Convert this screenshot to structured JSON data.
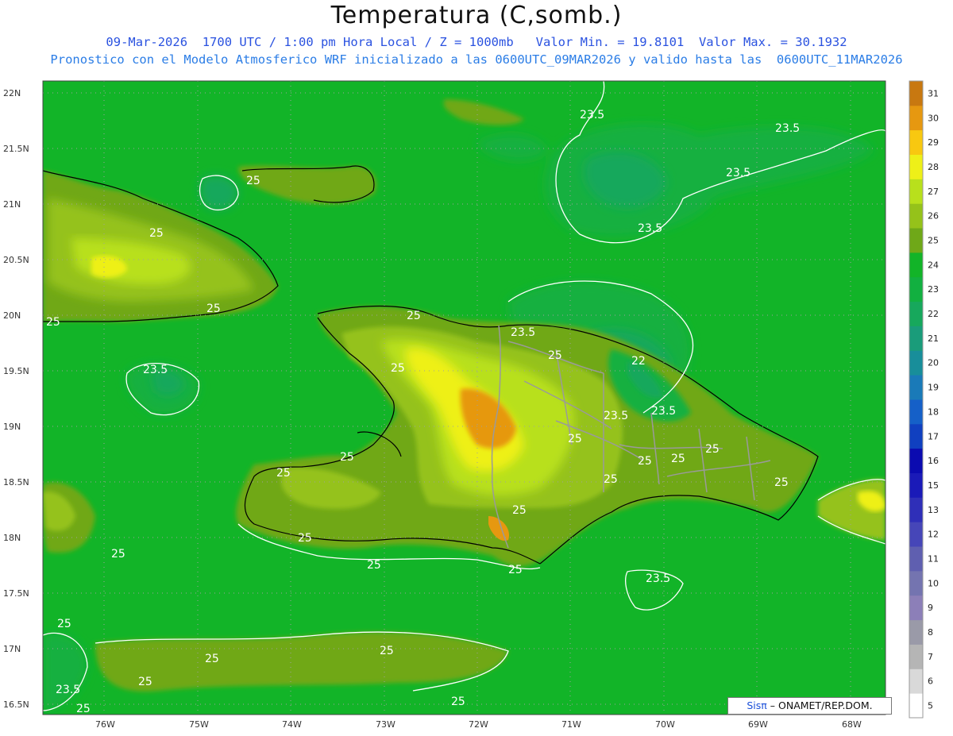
{
  "header": {
    "title": "Temperatura (C,somb.)",
    "line1": "09-Mar-2026  1700 UTC / 1:00 pm Hora Local / Z = 1000mb   Valor Min. = 19.8101  Valor Max. = 30.1932",
    "line2": "Pronostico con el Modelo Atmosferico WRF inicializado a las 0600UTC_09MAR2026 y valido hasta las  0600UTC_11MAR2026"
  },
  "axes": {
    "lat_labels": [
      "22N",
      "21.5N",
      "21N",
      "20.5N",
      "20N",
      "19.5N",
      "19N",
      "18.5N",
      "18N",
      "17.5N",
      "17N",
      "16.5N"
    ],
    "lon_labels": [
      "76W",
      "75W",
      "74W",
      "73W",
      "72W",
      "71W",
      "70W",
      "69W",
      "68W"
    ]
  },
  "colorbar": {
    "levels": [
      "5",
      "6",
      "7",
      "8",
      "9",
      "10",
      "11",
      "12",
      "13",
      "15",
      "16",
      "17",
      "18",
      "19",
      "20",
      "21",
      "22",
      "23",
      "24",
      "25",
      "26",
      "27",
      "28",
      "29",
      "30",
      "31"
    ],
    "colors": [
      "#ffffff",
      "#d9d9d9",
      "#b5b5b5",
      "#9a9aa8",
      "#8c7fb8",
      "#7474b0",
      "#5f5fb0",
      "#4646b8",
      "#2f2fb8",
      "#1a1ab8",
      "#0b0bb0",
      "#1040c0",
      "#1560c8",
      "#1a7ab8",
      "#188e9a",
      "#1a9c7a",
      "#17a85c",
      "#12b040",
      "#12b428",
      "#6fa818",
      "#95c21a",
      "#b8e01c",
      "#eef018",
      "#f8c810",
      "#e69810",
      "#c87810"
    ]
  },
  "contours": {
    "label_25": "25",
    "label_23_5": "23.5",
    "label_22": "22"
  },
  "credit": {
    "sis": "Sisπ",
    "org": "– ONAMET/REP.DOM."
  }
}
